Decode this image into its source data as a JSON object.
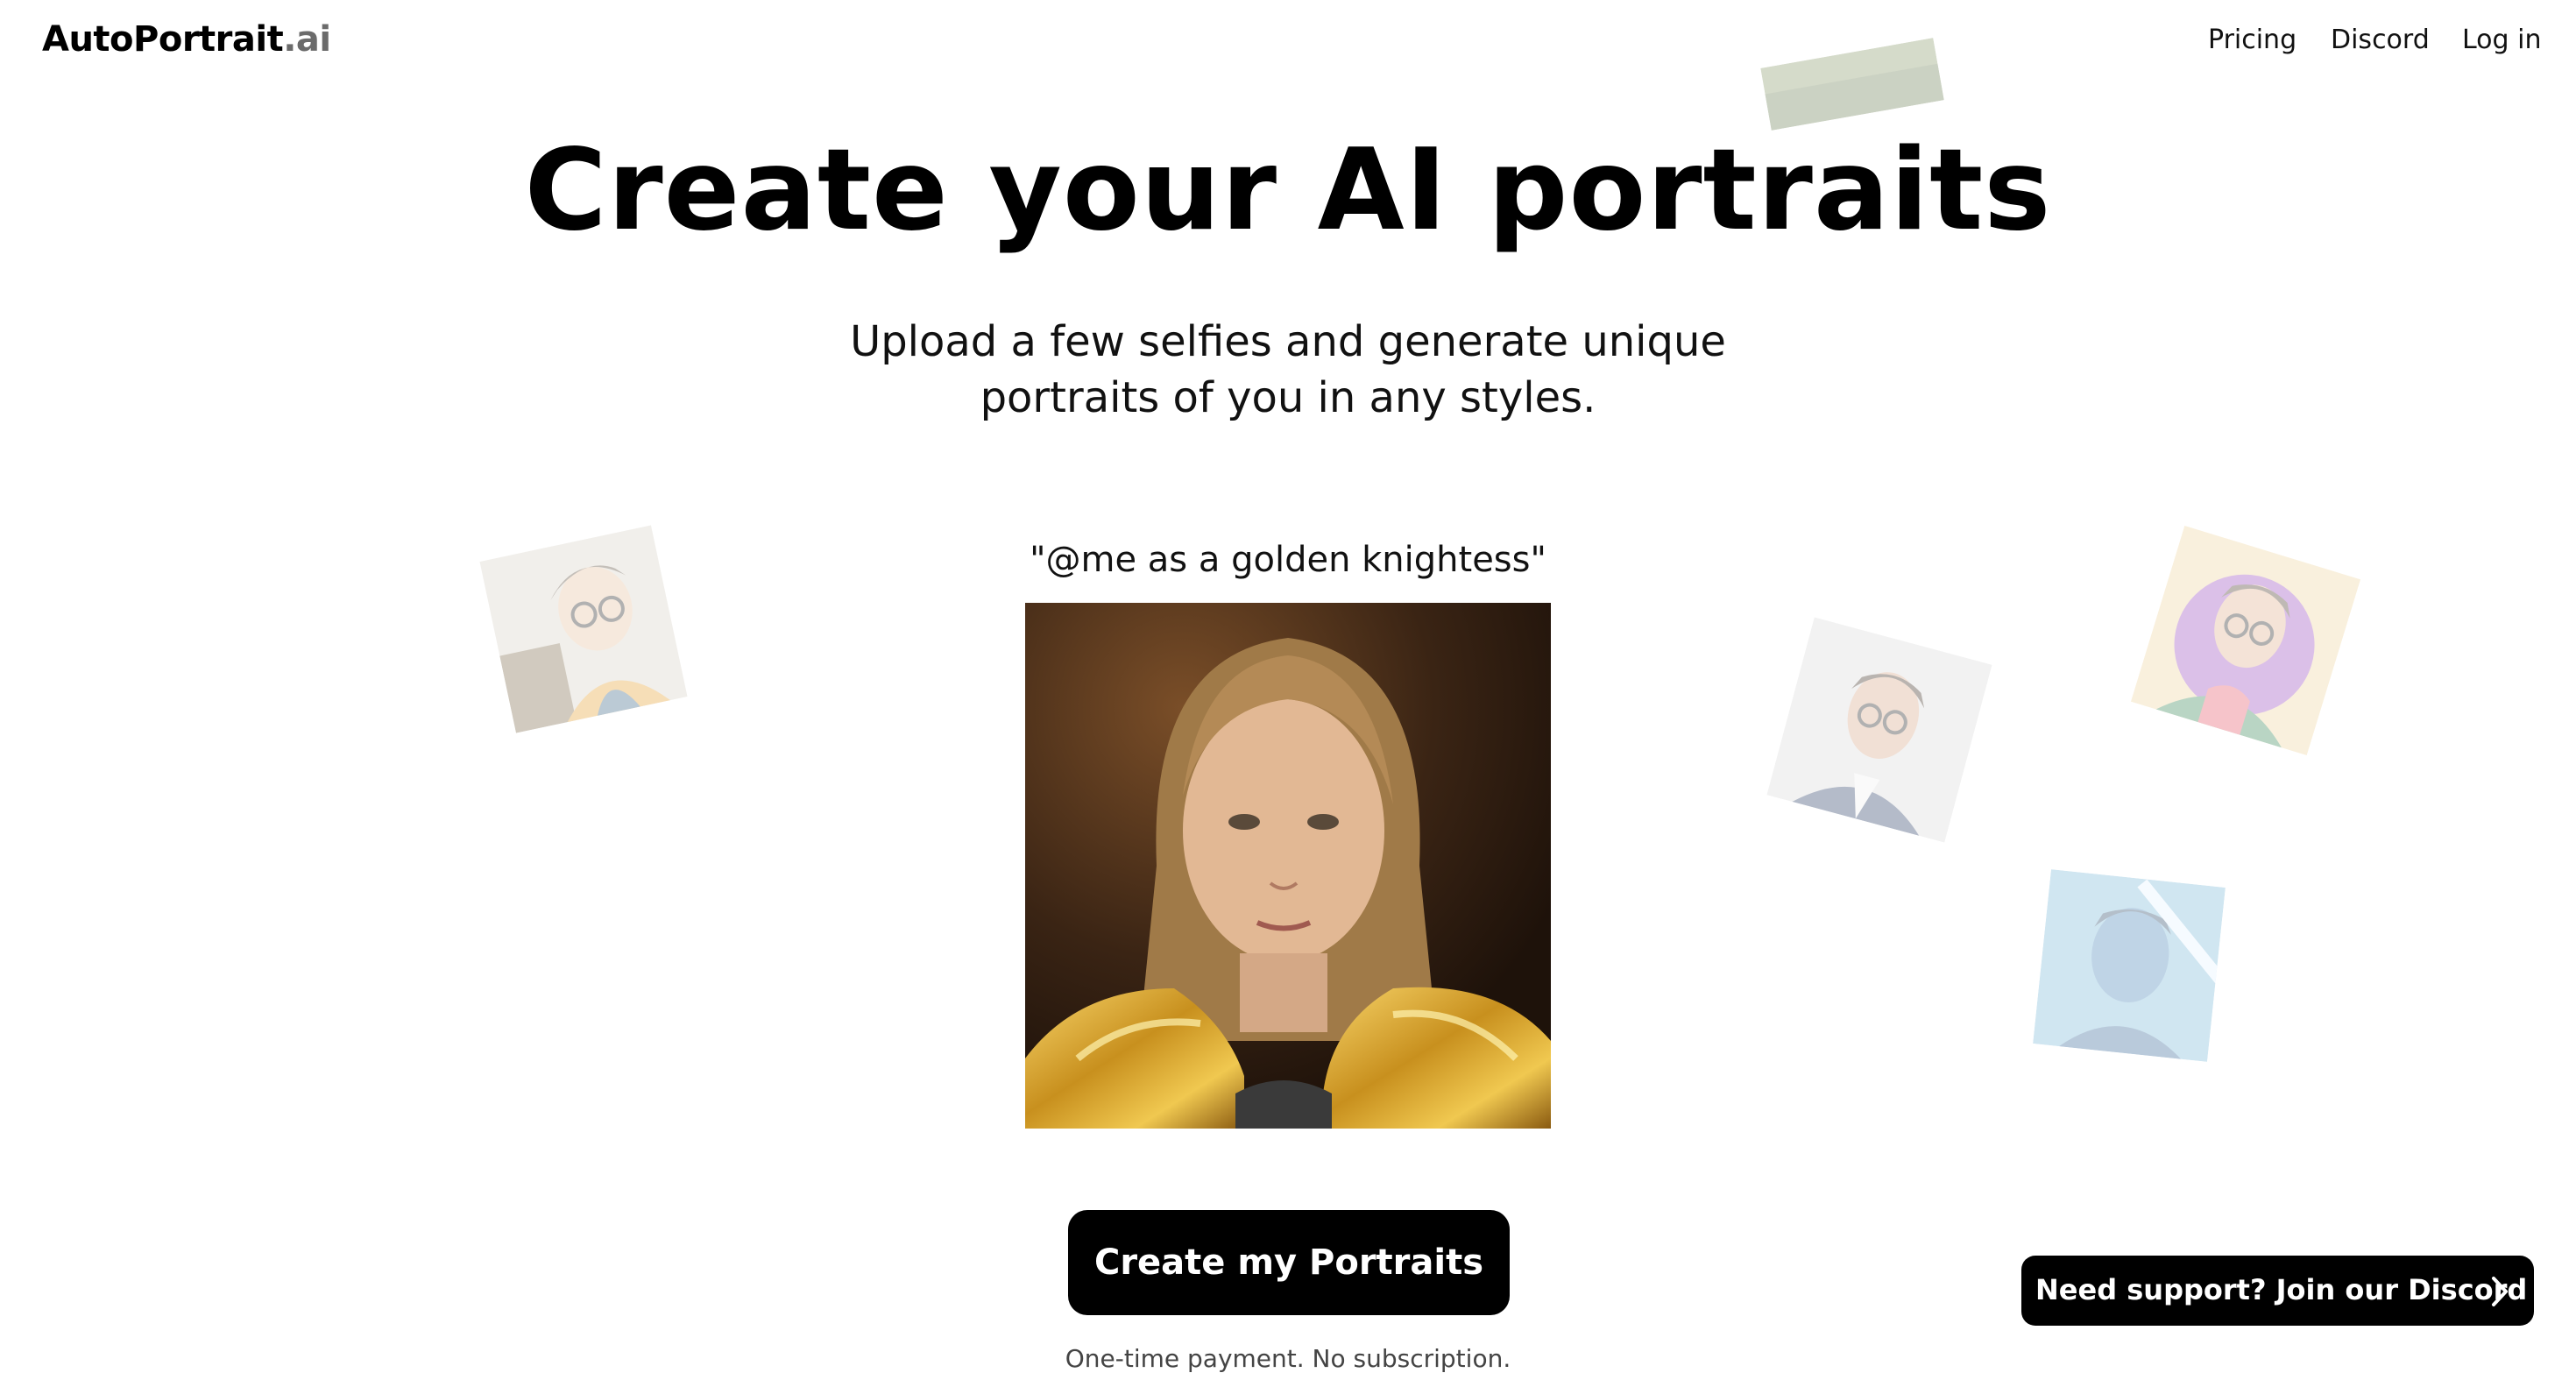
{
  "header": {
    "logo_main": "AutoPortrait",
    "logo_suffix": ".ai",
    "nav": [
      "Pricing",
      "Discord",
      "Log in"
    ]
  },
  "hero": {
    "title": "Create your AI portraits",
    "subtitle_line1": "Upload a few selfies and generate unique",
    "subtitle_line2": "portraits of you in any styles."
  },
  "showcase": {
    "prompt": "\"@me as a golden knightess\""
  },
  "cta": {
    "label": "Create my Portraits",
    "note": "One-time payment. No subscription."
  },
  "support": {
    "label": "Need support? Join our Discord"
  },
  "colors": {
    "background": "#ffffff",
    "button": "#000000",
    "logo_suffix": "#6b6b6b"
  }
}
